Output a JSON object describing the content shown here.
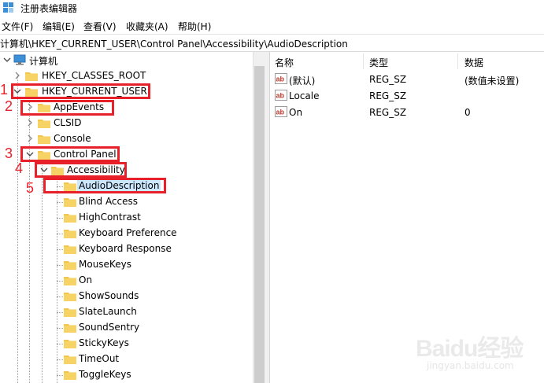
{
  "window": {
    "title": "注册表编辑器"
  },
  "menu": [
    "文件(F)",
    "编辑(E)",
    "查看(V)",
    "收藏夹(A)",
    "帮助(H)"
  ],
  "address": "计算机\\HKEY_CURRENT_USER\\Control Panel\\Accessibility\\AudioDescription",
  "tree": {
    "root": "计算机",
    "hkcr": "HKEY_CLASSES_ROOT",
    "hkcu": "HKEY_CURRENT_USER",
    "appevents": "AppEvents",
    "clsid": "CLSID",
    "console": "Console",
    "control_panel": "Control Panel",
    "accessibility": "Accessibility",
    "children": [
      "AudioDescription",
      "Blind Access",
      "HighContrast",
      "Keyboard Preference",
      "Keyboard Response",
      "MouseKeys",
      "On",
      "ShowSounds",
      "SlateLaunch",
      "SoundSentry",
      "StickyKeys",
      "TimeOut",
      "ToggleKeys"
    ],
    "selected": "AudioDescription"
  },
  "annotations": [
    "1",
    "2",
    "3",
    "4",
    "5"
  ],
  "values": {
    "headers": {
      "name": "名称",
      "type": "类型",
      "data": "数据"
    },
    "rows": [
      {
        "name": "(默认)",
        "type": "REG_SZ",
        "data": "(数值未设置)"
      },
      {
        "name": "Locale",
        "type": "REG_SZ",
        "data": ""
      },
      {
        "name": "On",
        "type": "REG_SZ",
        "data": "0"
      }
    ]
  },
  "watermark": {
    "logo": "Baidu经验",
    "url": "jingyan.baidu.com"
  },
  "colors": {
    "annotation_red": "#e8202a",
    "selection": "#cce8ff",
    "folder": "#f3c74b"
  },
  "icons": {
    "app": "registry-editor-icon",
    "computer": "computer-icon",
    "folder": "folder-icon",
    "value": "string-value-ab-icon",
    "expand": "chevron-right-icon",
    "collapse": "chevron-down-icon"
  }
}
